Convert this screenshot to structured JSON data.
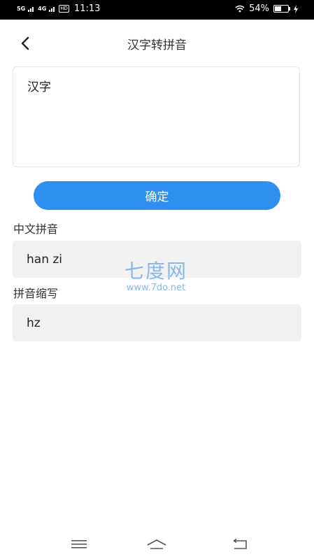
{
  "status_bar": {
    "signal_1": "5G",
    "signal_2": "4G",
    "hd_badge": "HD",
    "time": "11:13",
    "battery_percent": "54%",
    "battery_level": 0.54
  },
  "header": {
    "title": "汉字转拼音",
    "back_icon": "chevron-left-icon"
  },
  "input": {
    "value": "汉字"
  },
  "confirm_button": {
    "label": "确定",
    "color": "#2e8ff0"
  },
  "pinyin": {
    "label": "中文拼音",
    "value": "han zi"
  },
  "abbreviation": {
    "label": "拼音缩写",
    "value": "hz"
  },
  "watermark": {
    "title": "七度网",
    "url": "www.7do.net"
  },
  "nav_bar": {
    "menu_icon": "menu-icon",
    "home_icon": "home-icon",
    "back_icon": "return-icon"
  }
}
